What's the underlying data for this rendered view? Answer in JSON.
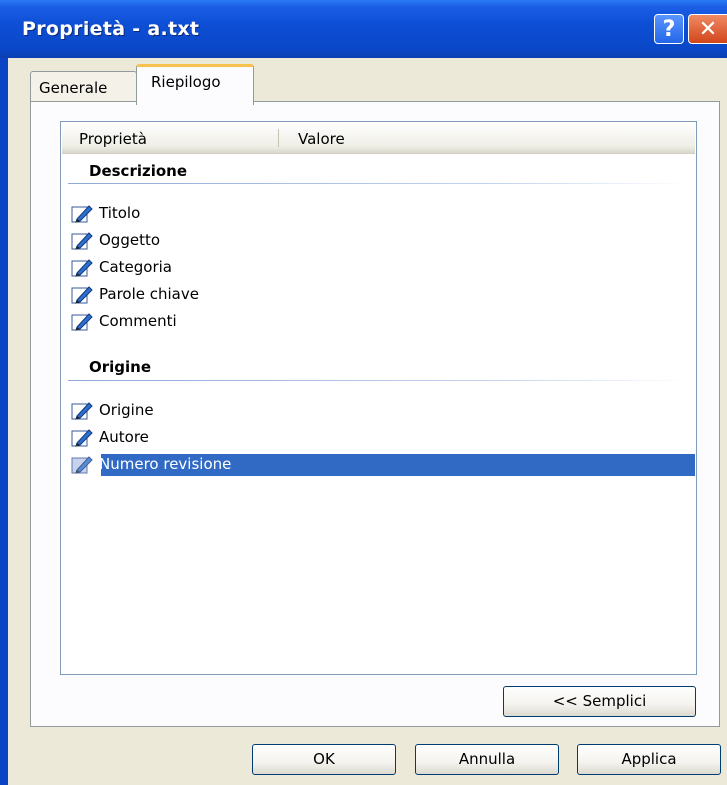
{
  "window": {
    "title": "Proprietà - a.txt",
    "help_label": "?",
    "close_label": "✕"
  },
  "tabs": [
    {
      "label": "Generale",
      "selected": false
    },
    {
      "label": "Riepilogo",
      "selected": true
    }
  ],
  "list": {
    "columns": [
      "Proprietà",
      "Valore"
    ],
    "groups": [
      {
        "title": "Descrizione",
        "items": [
          "Titolo",
          "Oggetto",
          "Categoria",
          "Parole chiave",
          "Commenti"
        ]
      },
      {
        "title": "Origine",
        "items": [
          "Origine",
          "Autore",
          "Numero revisione"
        ]
      }
    ],
    "selected_item": "Numero revisione",
    "icon": "edit-property-icon"
  },
  "buttons": {
    "simple": "<< Semplici",
    "ok": "OK",
    "cancel": "Annulla",
    "apply": "Applica"
  },
  "colors": {
    "titlebar": "#0a47c8",
    "selection": "#316ac5",
    "tab_accent": "#f7c34f"
  }
}
